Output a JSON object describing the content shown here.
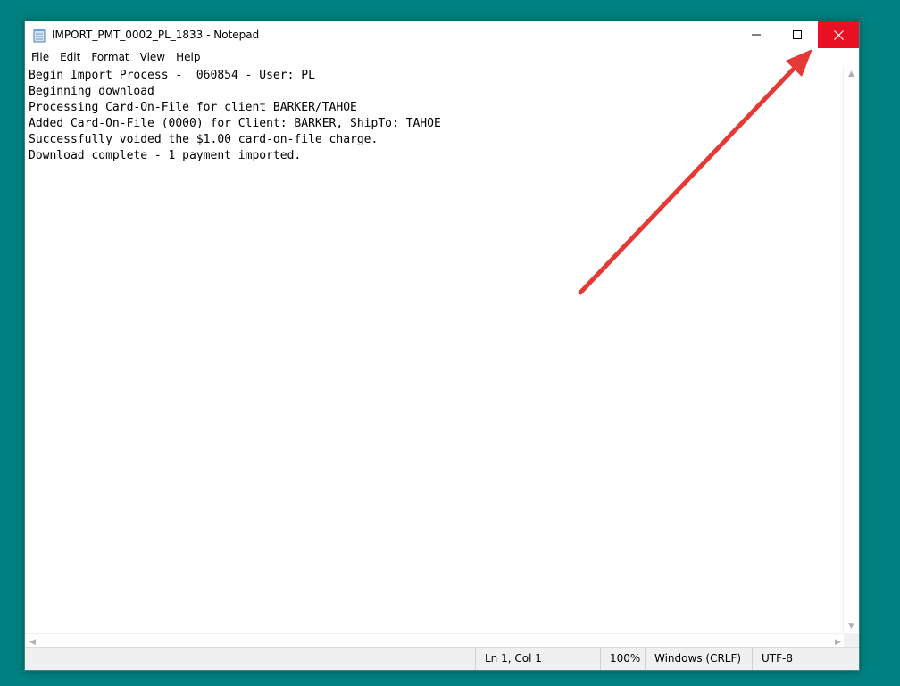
{
  "window": {
    "title": "IMPORT_PMT_0002_PL_1833 - Notepad"
  },
  "menu": {
    "items": [
      "File",
      "Edit",
      "Format",
      "View",
      "Help"
    ]
  },
  "editor": {
    "lines": [
      "Begin Import Process -  060854 - User: PL",
      "Beginning download",
      "Processing Card-On-File for client BARKER/TAHOE",
      "Added Card-On-File (0000) for Client: BARKER, ShipTo: TAHOE",
      "Successfully voided the $1.00 card-on-file charge.",
      "Download complete - 1 payment imported."
    ]
  },
  "status": {
    "position": "Ln 1, Col 1",
    "zoom": "100%",
    "line_ending": "Windows (CRLF)",
    "encoding": "UTF-8"
  },
  "icons": {
    "app": "notepad-icon",
    "minimize": "minimize-icon",
    "maximize": "maximize-icon",
    "close": "close-icon",
    "annotation": "red-arrow-icon"
  },
  "colors": {
    "desktop": "#008080",
    "close_button": "#e81123",
    "annotation_arrow": "#e53935"
  }
}
